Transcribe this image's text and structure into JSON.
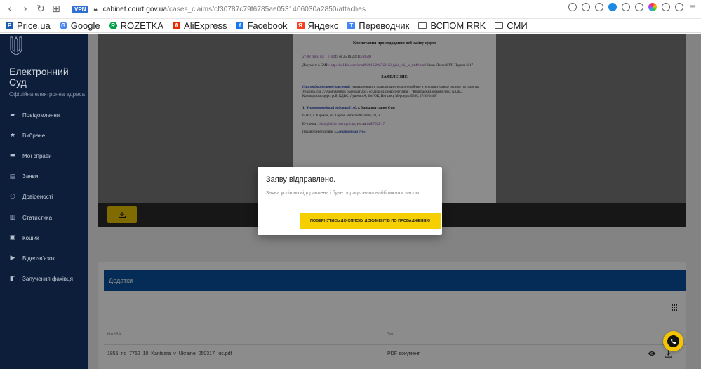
{
  "browser": {
    "vpn_label": "VPN",
    "url_domain": "cabinet.court.gov.ua",
    "url_path": "/cases_claims/cf30787c79f6785ae0531406030a2850/attaches"
  },
  "bookmarks": [
    {
      "label": "Price.ua",
      "icon": "price-ua-icon",
      "color": "#1b5fb5"
    },
    {
      "label": "Google",
      "icon": "google-icon",
      "color": "#4285f4"
    },
    {
      "label": "ROZETKA",
      "icon": "rozetka-icon",
      "color": "#00a046"
    },
    {
      "label": "AliExpress",
      "icon": "aliexpress-icon",
      "color": "#e62e04"
    },
    {
      "label": "Facebook",
      "icon": "facebook-icon",
      "color": "#1877f2"
    },
    {
      "label": "Яндекс",
      "icon": "yandex-icon",
      "color": "#fc3f1d"
    },
    {
      "label": "Переводчик",
      "icon": "translator-icon",
      "color": "#4285f4"
    },
    {
      "label": "ВСПОМ RRK",
      "icon": "folder-icon",
      "color": "#555555"
    },
    {
      "label": "СМИ",
      "icon": "folder-icon",
      "color": "#555555"
    }
  ],
  "sidebar": {
    "title": "Електронний Суд",
    "subtitle": "Офіційна електронна адреса",
    "items": [
      {
        "label": "Повідомлення",
        "icon": "message-icon"
      },
      {
        "label": "Вибране",
        "icon": "star-icon"
      },
      {
        "label": "Мої справи",
        "icon": "folder-icon"
      },
      {
        "label": "Заяви",
        "icon": "document-icon"
      },
      {
        "label": "Довіреності",
        "icon": "people-icon"
      },
      {
        "label": "Статистика",
        "icon": "chart-icon"
      },
      {
        "label": "Кошик",
        "icon": "trash-icon"
      },
      {
        "label": "Відеозв'язок",
        "icon": "video-icon"
      },
      {
        "label": "Залучення фахівця",
        "icon": "specialist-icon"
      }
    ]
  },
  "document": {
    "heading1": "Клопотання про огдадання веб-сайту судом",
    "ref_line": "от 25.10.2021г.",
    "ref_num": "21-03_Spis_vik__o_0449",
    "ref_code": "(3830)",
    "doc_label": "Документ в СМИ:",
    "doc_link": "http://ua1424.com/stradb/2016/2017/21-03_Spis_vik__o_0449.html",
    "doc_login": "Ника: Логин КУО Пароль 2117",
    "heading2": "ЗАЯВЛЕНИЕ",
    "para_lead": "Список документов/заявлений",
    "para_text": ", направленных в правоохранительно-судебные и исполнительные органы государства Украина, где 279 документов содержат 2657 ссылок на словосочетания - \"Кривбасжелдоркомплекс, ККЖС, Криворожжелдорстрой, КДВС, Луценко А, ИнГОК, Ингулец, Мерседес Е300, 27/89/0449\"",
    "court_num": "1.",
    "court_name": "Червонозаводский районный суд",
    "court_city": ", г. Харькова (далее Суд)",
    "address": "61001, г. Харьков, пл. Героев Небесной Сотни, 38, 3",
    "email_label": "Е - почта :",
    "email": "inbox@ch.hr.court.gov.ua",
    "phone_label": ", тел.на",
    "phone": "648/7032/17",
    "service_label": "Подано через сервис",
    "service": "«Электронный суд»"
  },
  "attachments": {
    "section_title": "Додатки",
    "col_name": "НАЗВА",
    "col_type": "Тип",
    "rows": [
      {
        "name": "1855_no_7762_10_Kantsara_v_Ukraine_050317_luc.pdf",
        "type": "PDF документ"
      }
    ]
  },
  "dialog": {
    "title": "Заяву відправлено.",
    "message": "Заява успішно відправлена і буде опрацьована найближчим часом.",
    "button_label": "ПОВЕРНУТИСЬ ДО СПИСКУ ДОКУМЕНТІВ ПО ПРОВАДЖЕННЮ"
  },
  "colors": {
    "sidebar_bg": "#0c1e3a",
    "accent_yellow": "#f5cf00",
    "header_blue": "#0a4f9e"
  }
}
